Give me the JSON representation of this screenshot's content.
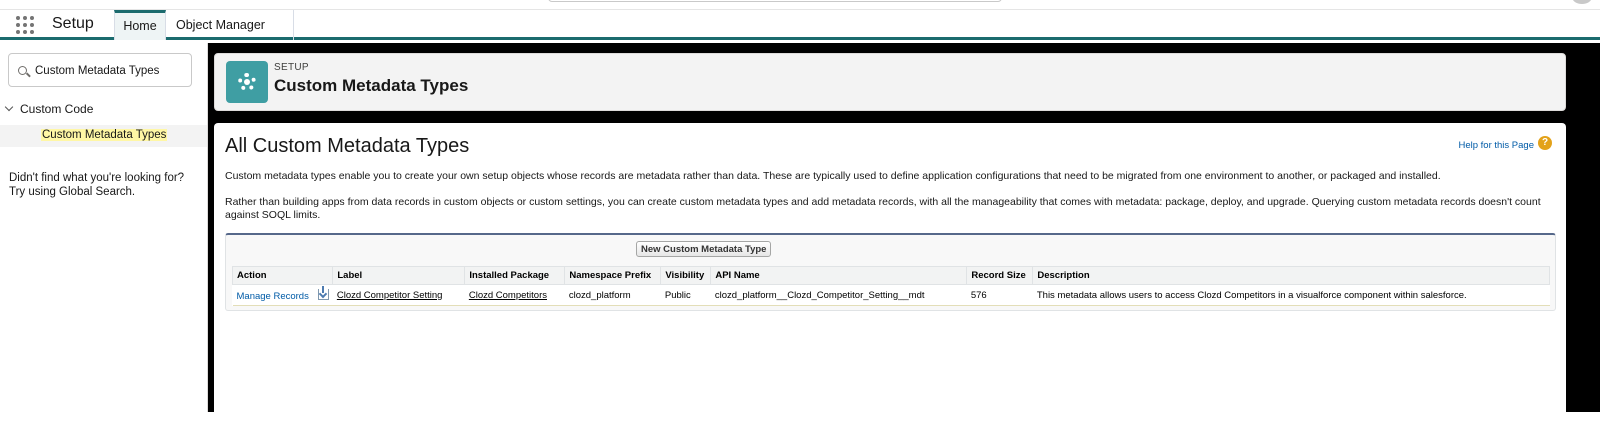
{
  "nav": {
    "app_name": "Setup",
    "tabs": [
      {
        "label": "Home"
      },
      {
        "label": "Object Manager"
      }
    ]
  },
  "sidebar": {
    "quickfind_value": "Custom Metadata Types",
    "group_label": "Custom Code",
    "selected_item": "Custom Metadata Types",
    "not_found_line1": "Didn't find what you're looking for?",
    "not_found_line2": "Try using Global Search."
  },
  "header": {
    "kicker": "SETUP",
    "title": "Custom Metadata Types"
  },
  "content": {
    "heading": "All Custom Metadata Types",
    "help_link": "Help for this Page",
    "help_icon": "?",
    "paragraph1": "Custom metadata types enable you to create your own setup objects whose records are metadata rather than data. These are typically used to define application configurations that need to be migrated from one environment to another, or packaged and installed.",
    "paragraph2": "Rather than building apps from data records in custom objects or custom settings, you can create custom metadata types and add metadata records, with all the manageability that comes with metadata: package, deploy, and upgrade. Querying custom metadata records doesn't count against SOQL limits.",
    "new_button": "New Custom Metadata Type"
  },
  "table": {
    "columns": [
      "Action",
      "Label",
      "Installed Package",
      "Namespace Prefix",
      "Visibility",
      "API Name",
      "Record Size",
      "Description"
    ],
    "rows": [
      {
        "action": "Manage Records",
        "label": "Clozd Competitor Setting",
        "installed_package": "Clozd Competitors",
        "namespace_prefix": "clozd_platform",
        "visibility": "Public",
        "api_name": "clozd_platform__Clozd_Competitor_Setting__mdt",
        "record_size": "576",
        "description": "This metadata allows users to access Clozd Competitors in a visualforce component within salesforce."
      }
    ]
  },
  "colors": {
    "brand_teal": "#1b6b6e",
    "header_icon": "#3f9ea3",
    "link_blue": "#015ba7",
    "help_orange": "#e3a21a"
  }
}
